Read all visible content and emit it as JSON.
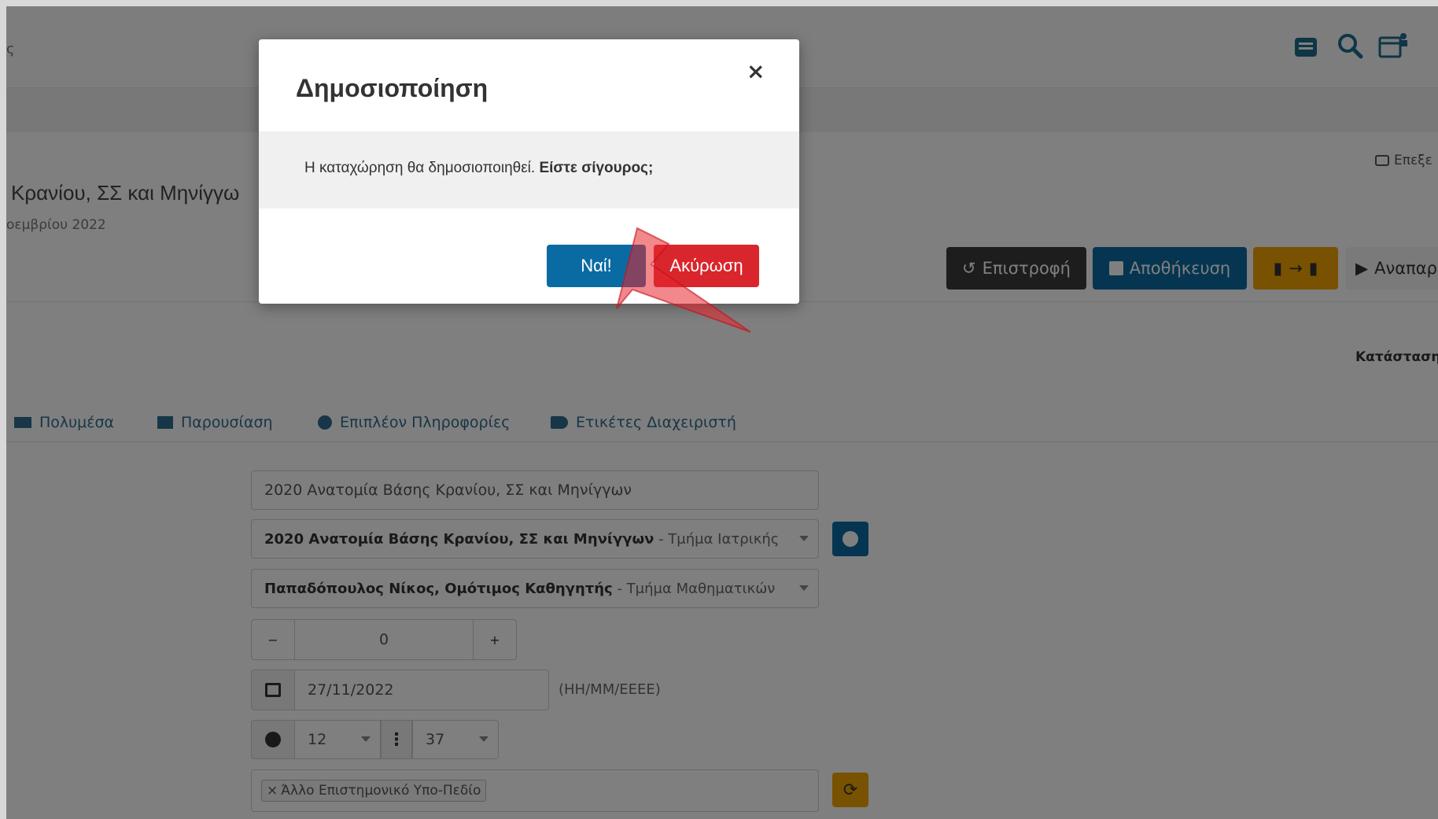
{
  "topbar": {
    "partial_text": "ς"
  },
  "page": {
    "title": "Κρανίου, ΣΣ και Μηνίγγω",
    "date": "οεμβρίου 2022",
    "comment_link": "Επεξε",
    "status_label": "Κατάσταση"
  },
  "header_buttons": {
    "back": "Επιστροφή",
    "save": "Αποθήκευση",
    "copy": "→",
    "play": "Αναπαρ"
  },
  "tabs": [
    {
      "label": "Πολυμέσα"
    },
    {
      "label": "Παρουσίαση"
    },
    {
      "label": "Επιπλέον Πληροφορίες"
    },
    {
      "label": "Ετικέτες Διαχειριστή"
    }
  ],
  "form": {
    "title_value": "2020 Ανατομία Βάσης Κρανίου, ΣΣ και Μηνίγγων",
    "course_bold": "2020 Ανατομία Βάσης Κρανίου, ΣΣ και Μηνίγγων",
    "course_dept": " - Τμήμα Ιατρικής",
    "speaker_bold": "Παπαδόπουλος Νίκος, Ομότιμος Καθηγητής",
    "speaker_dept": " - Τμήμα Μαθηματικών",
    "stepper_minus": "−",
    "stepper_value": "0",
    "stepper_plus": "+",
    "date_value": "27/11/2022",
    "date_hint": "(ΗΗ/ΜΜ/ΕΕΕΕ)",
    "hour_value": "12",
    "minute_value": "37",
    "tag_remove": "×",
    "tag_value": "Άλλο Επιστημονικό Υπο-Πεδίο"
  },
  "modal": {
    "title": "Δημοσιοποίηση",
    "close": "×",
    "message_prefix": "Η καταχώρηση θα δημοσιοποιηθεί. ",
    "message_bold": "Είστε σίγουρος;",
    "yes_label": "Ναί!",
    "cancel_label": "Ακύρωση"
  },
  "colors": {
    "primary": "#0a6ba3",
    "danger": "#d9262c",
    "warning": "#f0a500",
    "default_btn": "#3a3a3a",
    "arrow": "#e8242e"
  },
  "icons": [
    "inbox-icon",
    "search-icon",
    "calendar-user-icon",
    "undo-icon",
    "save-icon",
    "copy-icon",
    "play-icon",
    "video-icon",
    "presentation-icon",
    "info-icon",
    "tags-icon",
    "calendar-icon",
    "clock-icon",
    "refresh-icon",
    "comment-icon"
  ]
}
